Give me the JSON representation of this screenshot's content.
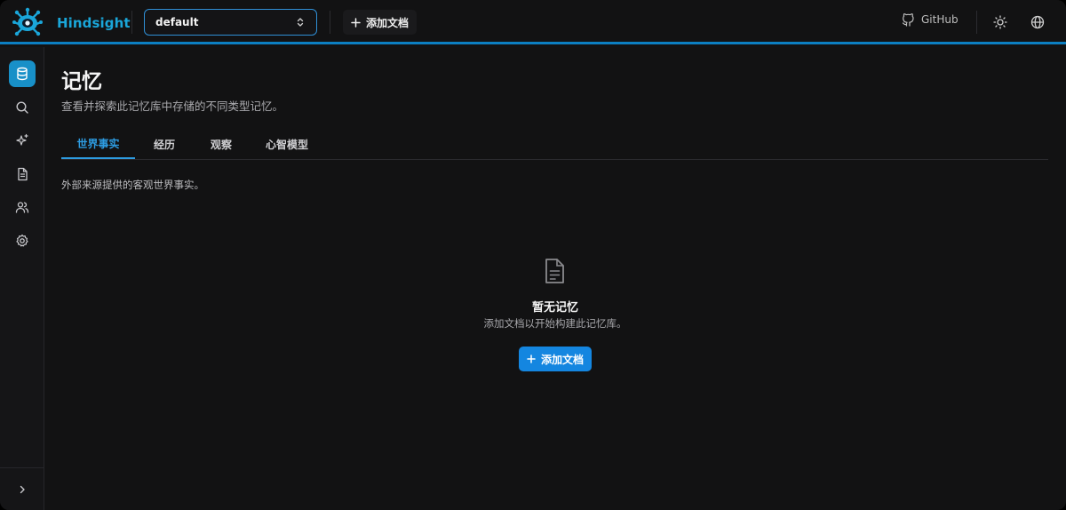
{
  "header": {
    "brand": "Hindsight",
    "bank_select": {
      "value": "default"
    },
    "add_document_label": "添加文档",
    "github_label": "GitHub"
  },
  "sidebar": {
    "items": [
      {
        "name": "memories",
        "icon": "database-icon",
        "active": true
      },
      {
        "name": "search",
        "icon": "search-icon",
        "active": false
      },
      {
        "name": "insights",
        "icon": "sparkles-icon",
        "active": false
      },
      {
        "name": "documents",
        "icon": "document-icon",
        "active": false
      },
      {
        "name": "entities",
        "icon": "users-icon",
        "active": false
      },
      {
        "name": "settings",
        "icon": "gear-icon",
        "active": false
      }
    ],
    "collapse_icon": "chevron-right-icon"
  },
  "main": {
    "title": "记忆",
    "subtitle": "查看并探索此记忆库中存储的不同类型记忆。",
    "tabs": [
      {
        "label": "世界事实",
        "active": true
      },
      {
        "label": "经历",
        "active": false
      },
      {
        "label": "观察",
        "active": false
      },
      {
        "label": "心智模型",
        "active": false
      }
    ],
    "tab_description": "外部来源提供的客观世界事实。",
    "empty_state": {
      "icon": "file-text-icon",
      "title": "暂无记忆",
      "description": "添加文档以开始构建此记忆库。",
      "button_label": "添加文档"
    }
  },
  "colors": {
    "accent": "#1486e0",
    "brand": "#1aa6d9",
    "background": "#121213"
  }
}
